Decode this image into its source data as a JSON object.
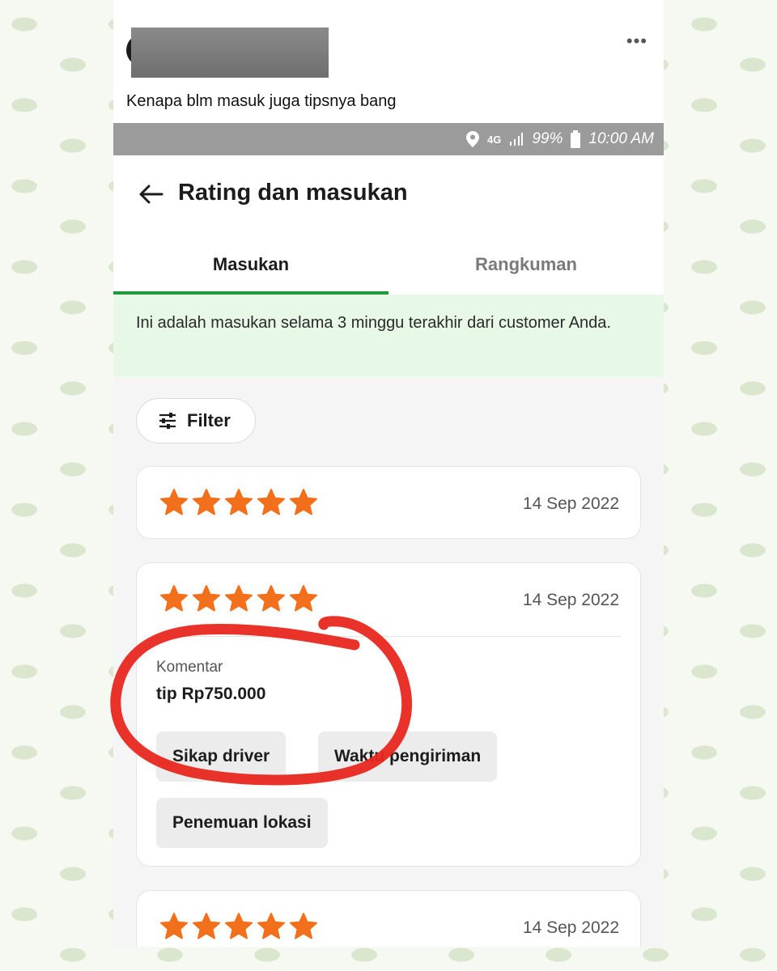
{
  "post": {
    "caption": "Kenapa blm masuk juga tipsnya bang",
    "more_icon": "more-dots-icon"
  },
  "status_bar": {
    "network": "4G",
    "battery": "99%",
    "time": "10:00 AM"
  },
  "header": {
    "title": "Rating dan masukan",
    "back_icon": "arrow-left-icon"
  },
  "tabs": [
    {
      "label": "Masukan",
      "active": true
    },
    {
      "label": "Rangkuman",
      "active": false
    }
  ],
  "banner": {
    "text": "Ini adalah masukan selama 3 minggu terakhir dari customer Anda."
  },
  "filter": {
    "label": "Filter",
    "icon": "sliders-icon"
  },
  "reviews": [
    {
      "stars": 5,
      "date": "14 Sep 2022"
    },
    {
      "stars": 5,
      "date": "14 Sep 2022",
      "comment_label": "Komentar",
      "comment": "tip Rp750.000",
      "tags": [
        "Sikap driver",
        "Waktu pengiriman",
        "Penemuan lokasi"
      ]
    },
    {
      "stars": 5,
      "date": "14 Sep 2022"
    }
  ],
  "colors": {
    "accent_green": "#1f9a3b",
    "banner_bg": "#e8f8e6",
    "star": "#f26f1b",
    "annotation_red": "#e8271d"
  }
}
